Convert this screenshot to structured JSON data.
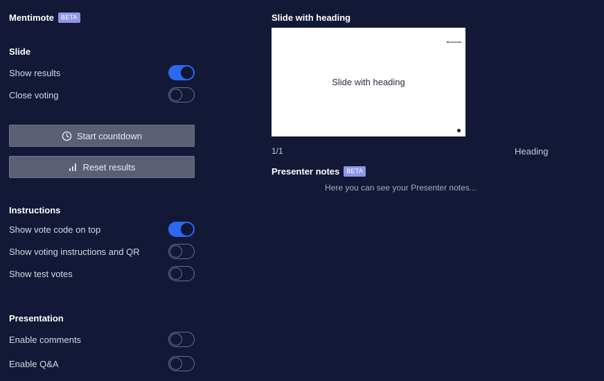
{
  "app": {
    "title": "Mentimote",
    "badge": "BETA"
  },
  "slide_section": {
    "heading": "Slide",
    "toggles": [
      {
        "label": "Show results",
        "on": true
      },
      {
        "label": "Close voting",
        "on": false
      }
    ],
    "buttons": {
      "start_countdown": "Start countdown",
      "reset_results": "Reset results"
    }
  },
  "instructions_section": {
    "heading": "Instructions",
    "toggles": [
      {
        "label": "Show vote code on top",
        "on": true
      },
      {
        "label": "Show voting instructions and QR",
        "on": false
      },
      {
        "label": "Show test votes",
        "on": false
      }
    ]
  },
  "presentation_section": {
    "heading": "Presentation",
    "toggles": [
      {
        "label": "Enable comments",
        "on": false
      },
      {
        "label": "Enable Q&A",
        "on": false
      }
    ]
  },
  "preview": {
    "title": "Slide with heading",
    "slide_heading": "Slide with heading",
    "slide_logo": "Mentimeter",
    "counter": "1/1",
    "slide_type": "Heading"
  },
  "notes": {
    "title": "Presenter notes",
    "badge": "BETA",
    "text": "Here you can see your Presenter notes..."
  },
  "colors": {
    "background": "#121836",
    "toggle_on": "#2d68f0",
    "badge": "#8f95e6",
    "button": "#5a5f75"
  }
}
